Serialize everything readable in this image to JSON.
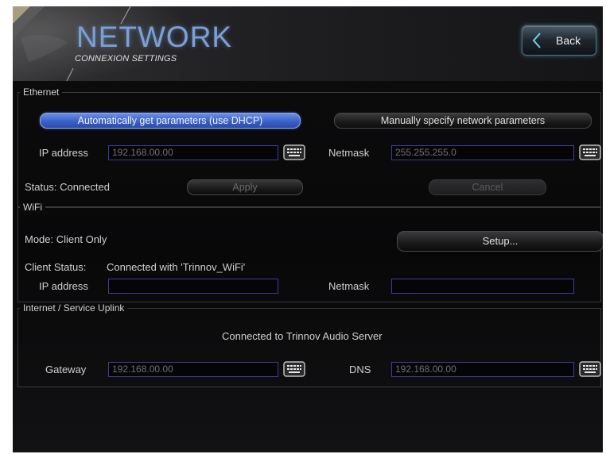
{
  "header": {
    "title": "NETWORK",
    "subtitle": "CONNEXION SETTINGS",
    "back_label": "Back"
  },
  "ethernet": {
    "legend": "Ethernet",
    "dhcp_button": "Automatically get parameters (use DHCP)",
    "manual_button": "Manually specify network parameters",
    "ip_label": "IP address",
    "ip_value": "192.168.00.00",
    "netmask_label": "Netmask",
    "netmask_value": "255.255.255.0",
    "status_text": "Status: Connected",
    "apply_button": "Apply",
    "cancel_button": "Cancel"
  },
  "wifi": {
    "legend": "WiFi",
    "mode_text": "Mode:  Client Only",
    "setup_button": "Setup...",
    "client_status_label": "Client Status:",
    "client_status_value": "Connected with 'Trinnov_WiFi'",
    "ip_label": "IP address",
    "ip_value": "",
    "netmask_label": "Netmask",
    "netmask_value": ""
  },
  "uplink": {
    "legend": "Internet / Service Uplink",
    "status_text": "Connected to Trinnov Audio Server",
    "gateway_label": "Gateway",
    "gateway_value": "192.168.00.00",
    "dns_label": "DNS",
    "dns_value": "192.168.00.00"
  },
  "colors": {
    "accent_blue": "#3a62c8",
    "title_blue": "#7aa0d8",
    "field_border": "#3c3ca0"
  },
  "icons": [
    "chevron-left-icon",
    "keyboard-icon"
  ]
}
